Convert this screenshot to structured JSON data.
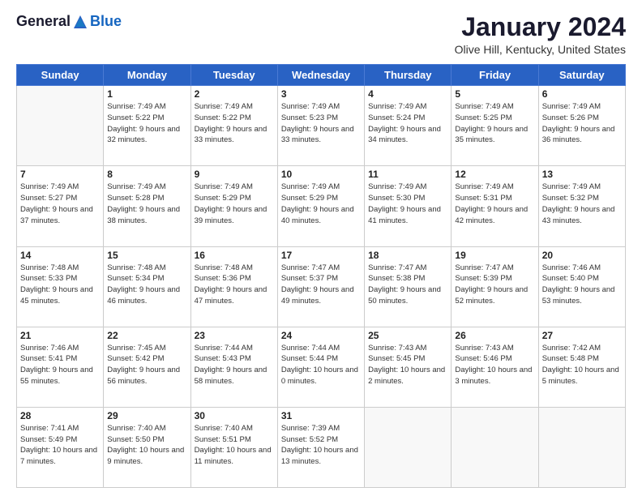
{
  "header": {
    "logo": {
      "general": "General",
      "blue": "Blue"
    },
    "title": "January 2024",
    "location": "Olive Hill, Kentucky, United States"
  },
  "weekdays": [
    "Sunday",
    "Monday",
    "Tuesday",
    "Wednesday",
    "Thursday",
    "Friday",
    "Saturday"
  ],
  "weeks": [
    [
      {
        "day": "",
        "empty": true
      },
      {
        "day": "1",
        "sunrise": "Sunrise: 7:49 AM",
        "sunset": "Sunset: 5:22 PM",
        "daylight": "Daylight: 9 hours and 32 minutes."
      },
      {
        "day": "2",
        "sunrise": "Sunrise: 7:49 AM",
        "sunset": "Sunset: 5:22 PM",
        "daylight": "Daylight: 9 hours and 33 minutes."
      },
      {
        "day": "3",
        "sunrise": "Sunrise: 7:49 AM",
        "sunset": "Sunset: 5:23 PM",
        "daylight": "Daylight: 9 hours and 33 minutes."
      },
      {
        "day": "4",
        "sunrise": "Sunrise: 7:49 AM",
        "sunset": "Sunset: 5:24 PM",
        "daylight": "Daylight: 9 hours and 34 minutes."
      },
      {
        "day": "5",
        "sunrise": "Sunrise: 7:49 AM",
        "sunset": "Sunset: 5:25 PM",
        "daylight": "Daylight: 9 hours and 35 minutes."
      },
      {
        "day": "6",
        "sunrise": "Sunrise: 7:49 AM",
        "sunset": "Sunset: 5:26 PM",
        "daylight": "Daylight: 9 hours and 36 minutes."
      }
    ],
    [
      {
        "day": "7",
        "sunrise": "Sunrise: 7:49 AM",
        "sunset": "Sunset: 5:27 PM",
        "daylight": "Daylight: 9 hours and 37 minutes."
      },
      {
        "day": "8",
        "sunrise": "Sunrise: 7:49 AM",
        "sunset": "Sunset: 5:28 PM",
        "daylight": "Daylight: 9 hours and 38 minutes."
      },
      {
        "day": "9",
        "sunrise": "Sunrise: 7:49 AM",
        "sunset": "Sunset: 5:29 PM",
        "daylight": "Daylight: 9 hours and 39 minutes."
      },
      {
        "day": "10",
        "sunrise": "Sunrise: 7:49 AM",
        "sunset": "Sunset: 5:29 PM",
        "daylight": "Daylight: 9 hours and 40 minutes."
      },
      {
        "day": "11",
        "sunrise": "Sunrise: 7:49 AM",
        "sunset": "Sunset: 5:30 PM",
        "daylight": "Daylight: 9 hours and 41 minutes."
      },
      {
        "day": "12",
        "sunrise": "Sunrise: 7:49 AM",
        "sunset": "Sunset: 5:31 PM",
        "daylight": "Daylight: 9 hours and 42 minutes."
      },
      {
        "day": "13",
        "sunrise": "Sunrise: 7:49 AM",
        "sunset": "Sunset: 5:32 PM",
        "daylight": "Daylight: 9 hours and 43 minutes."
      }
    ],
    [
      {
        "day": "14",
        "sunrise": "Sunrise: 7:48 AM",
        "sunset": "Sunset: 5:33 PM",
        "daylight": "Daylight: 9 hours and 45 minutes."
      },
      {
        "day": "15",
        "sunrise": "Sunrise: 7:48 AM",
        "sunset": "Sunset: 5:34 PM",
        "daylight": "Daylight: 9 hours and 46 minutes."
      },
      {
        "day": "16",
        "sunrise": "Sunrise: 7:48 AM",
        "sunset": "Sunset: 5:36 PM",
        "daylight": "Daylight: 9 hours and 47 minutes."
      },
      {
        "day": "17",
        "sunrise": "Sunrise: 7:47 AM",
        "sunset": "Sunset: 5:37 PM",
        "daylight": "Daylight: 9 hours and 49 minutes."
      },
      {
        "day": "18",
        "sunrise": "Sunrise: 7:47 AM",
        "sunset": "Sunset: 5:38 PM",
        "daylight": "Daylight: 9 hours and 50 minutes."
      },
      {
        "day": "19",
        "sunrise": "Sunrise: 7:47 AM",
        "sunset": "Sunset: 5:39 PM",
        "daylight": "Daylight: 9 hours and 52 minutes."
      },
      {
        "day": "20",
        "sunrise": "Sunrise: 7:46 AM",
        "sunset": "Sunset: 5:40 PM",
        "daylight": "Daylight: 9 hours and 53 minutes."
      }
    ],
    [
      {
        "day": "21",
        "sunrise": "Sunrise: 7:46 AM",
        "sunset": "Sunset: 5:41 PM",
        "daylight": "Daylight: 9 hours and 55 minutes."
      },
      {
        "day": "22",
        "sunrise": "Sunrise: 7:45 AM",
        "sunset": "Sunset: 5:42 PM",
        "daylight": "Daylight: 9 hours and 56 minutes."
      },
      {
        "day": "23",
        "sunrise": "Sunrise: 7:44 AM",
        "sunset": "Sunset: 5:43 PM",
        "daylight": "Daylight: 9 hours and 58 minutes."
      },
      {
        "day": "24",
        "sunrise": "Sunrise: 7:44 AM",
        "sunset": "Sunset: 5:44 PM",
        "daylight": "Daylight: 10 hours and 0 minutes."
      },
      {
        "day": "25",
        "sunrise": "Sunrise: 7:43 AM",
        "sunset": "Sunset: 5:45 PM",
        "daylight": "Daylight: 10 hours and 2 minutes."
      },
      {
        "day": "26",
        "sunrise": "Sunrise: 7:43 AM",
        "sunset": "Sunset: 5:46 PM",
        "daylight": "Daylight: 10 hours and 3 minutes."
      },
      {
        "day": "27",
        "sunrise": "Sunrise: 7:42 AM",
        "sunset": "Sunset: 5:48 PM",
        "daylight": "Daylight: 10 hours and 5 minutes."
      }
    ],
    [
      {
        "day": "28",
        "sunrise": "Sunrise: 7:41 AM",
        "sunset": "Sunset: 5:49 PM",
        "daylight": "Daylight: 10 hours and 7 minutes."
      },
      {
        "day": "29",
        "sunrise": "Sunrise: 7:40 AM",
        "sunset": "Sunset: 5:50 PM",
        "daylight": "Daylight: 10 hours and 9 minutes."
      },
      {
        "day": "30",
        "sunrise": "Sunrise: 7:40 AM",
        "sunset": "Sunset: 5:51 PM",
        "daylight": "Daylight: 10 hours and 11 minutes."
      },
      {
        "day": "31",
        "sunrise": "Sunrise: 7:39 AM",
        "sunset": "Sunset: 5:52 PM",
        "daylight": "Daylight: 10 hours and 13 minutes."
      },
      {
        "day": "",
        "empty": true
      },
      {
        "day": "",
        "empty": true
      },
      {
        "day": "",
        "empty": true
      }
    ]
  ]
}
